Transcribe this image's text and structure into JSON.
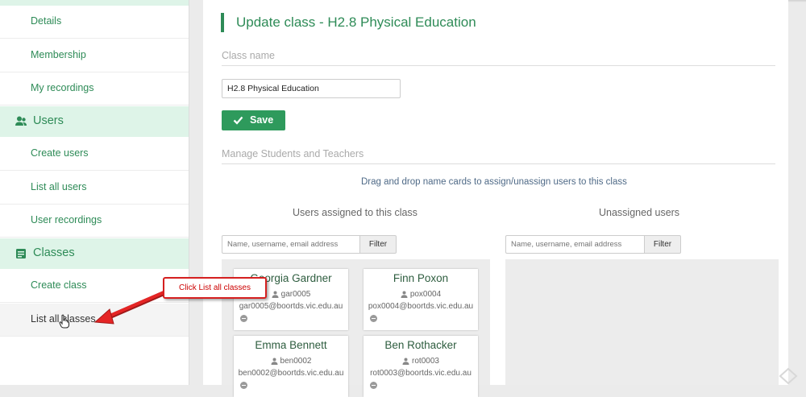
{
  "sidebar": {
    "items_top": [
      {
        "label": "Details"
      },
      {
        "label": "Membership"
      },
      {
        "label": "My recordings"
      }
    ],
    "users_section": {
      "title": "Users",
      "icon": "users-icon"
    },
    "users_items": [
      {
        "label": "Create users"
      },
      {
        "label": "List all users"
      },
      {
        "label": "User recordings"
      }
    ],
    "classes_section": {
      "title": "Classes",
      "icon": "classes-icon"
    },
    "classes_items": [
      {
        "label": "Create class"
      },
      {
        "label": "List all classes"
      }
    ]
  },
  "main": {
    "title": "Update class - H2.8 Physical Education",
    "class_name_label": "Class name",
    "class_name_value": "H2.8 Physical Education",
    "save_label": "Save",
    "manage_label": "Manage Students and Teachers",
    "hint": "Drag and drop name cards to assign/unassign users to this class",
    "assigned": {
      "heading": "Users assigned to this class",
      "search_placeholder": "Name, username, email address",
      "filter_label": "Filter",
      "cards": [
        {
          "name": "Georgia Gardner",
          "username": "gar0005",
          "email": "gar0005@boortds.vic.edu.au"
        },
        {
          "name": "Finn Poxon",
          "username": "pox0004",
          "email": "pox0004@boortds.vic.edu.au"
        },
        {
          "name": "Emma Bennett",
          "username": "ben0002",
          "email": "ben0002@boortds.vic.edu.au"
        },
        {
          "name": "Ben Rothacker",
          "username": "rot0003",
          "email": "rot0003@boortds.vic.edu.au"
        }
      ]
    },
    "unassigned": {
      "heading": "Unassigned users",
      "search_placeholder": "Name, username, email address",
      "filter_label": "Filter"
    }
  },
  "annotation": {
    "callout_text": "Click List all classes"
  },
  "colors": {
    "accent": "#2e8b57",
    "callout_border": "#d51f1f",
    "section_bg": "#def4e8"
  }
}
